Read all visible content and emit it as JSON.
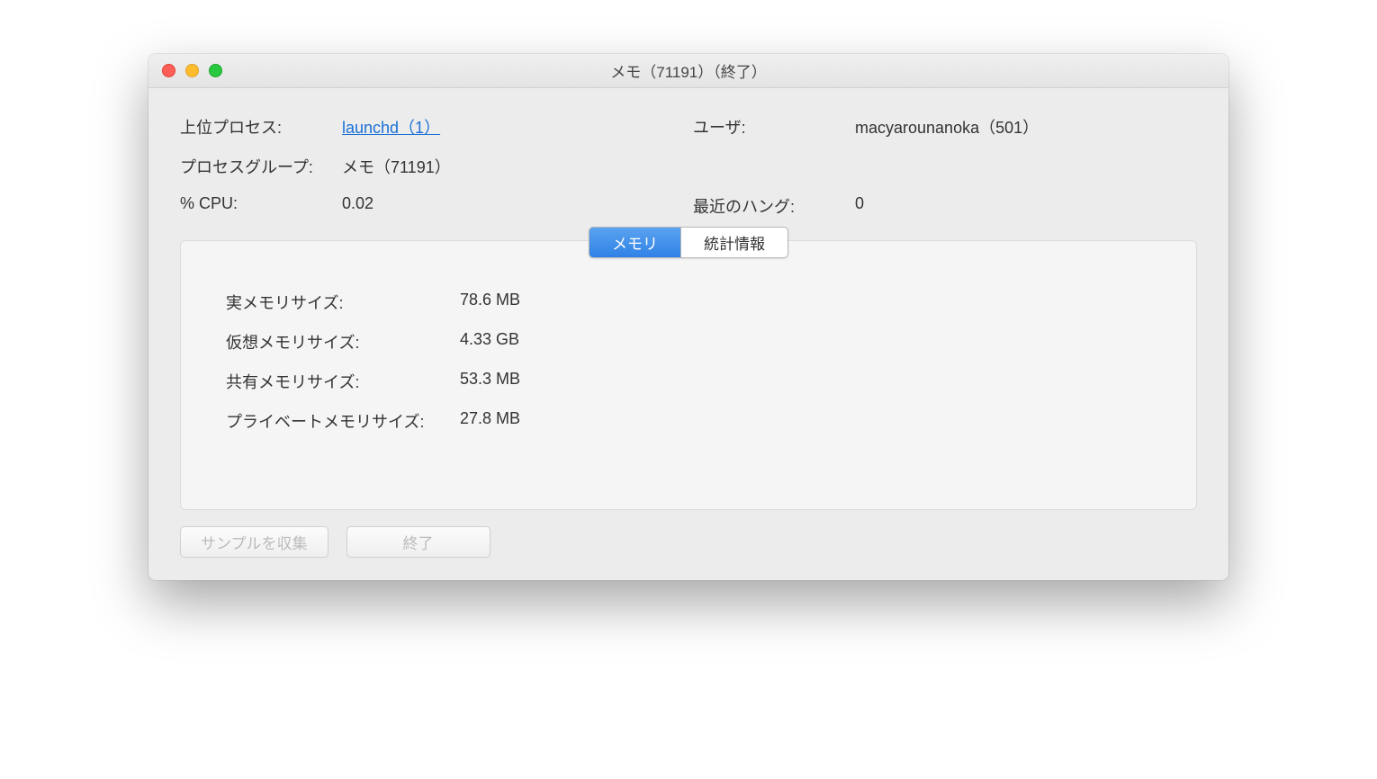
{
  "window": {
    "title": "メモ（71191）（終了）"
  },
  "info": {
    "parent_label": "上位プロセス:",
    "parent_value": "launchd（1）",
    "group_label": "プロセスグループ:",
    "group_value": "メモ（71191）",
    "cpu_label": "% CPU:",
    "cpu_value": "0.02",
    "user_label": "ユーザ:",
    "user_value": "macyarounanoka（501）",
    "hangs_label": "最近のハング:",
    "hangs_value": "0"
  },
  "tabs": {
    "memory": "メモリ",
    "stats": "統計情報"
  },
  "memory": {
    "real_label": "実メモリサイズ:",
    "real_value": "78.6 MB",
    "virtual_label": "仮想メモリサイズ:",
    "virtual_value": "4.33 GB",
    "shared_label": "共有メモリサイズ:",
    "shared_value": "53.3 MB",
    "private_label": "プライベートメモリサイズ:",
    "private_value": "27.8 MB"
  },
  "footer": {
    "sample": "サンプルを収集",
    "quit": "終了"
  }
}
